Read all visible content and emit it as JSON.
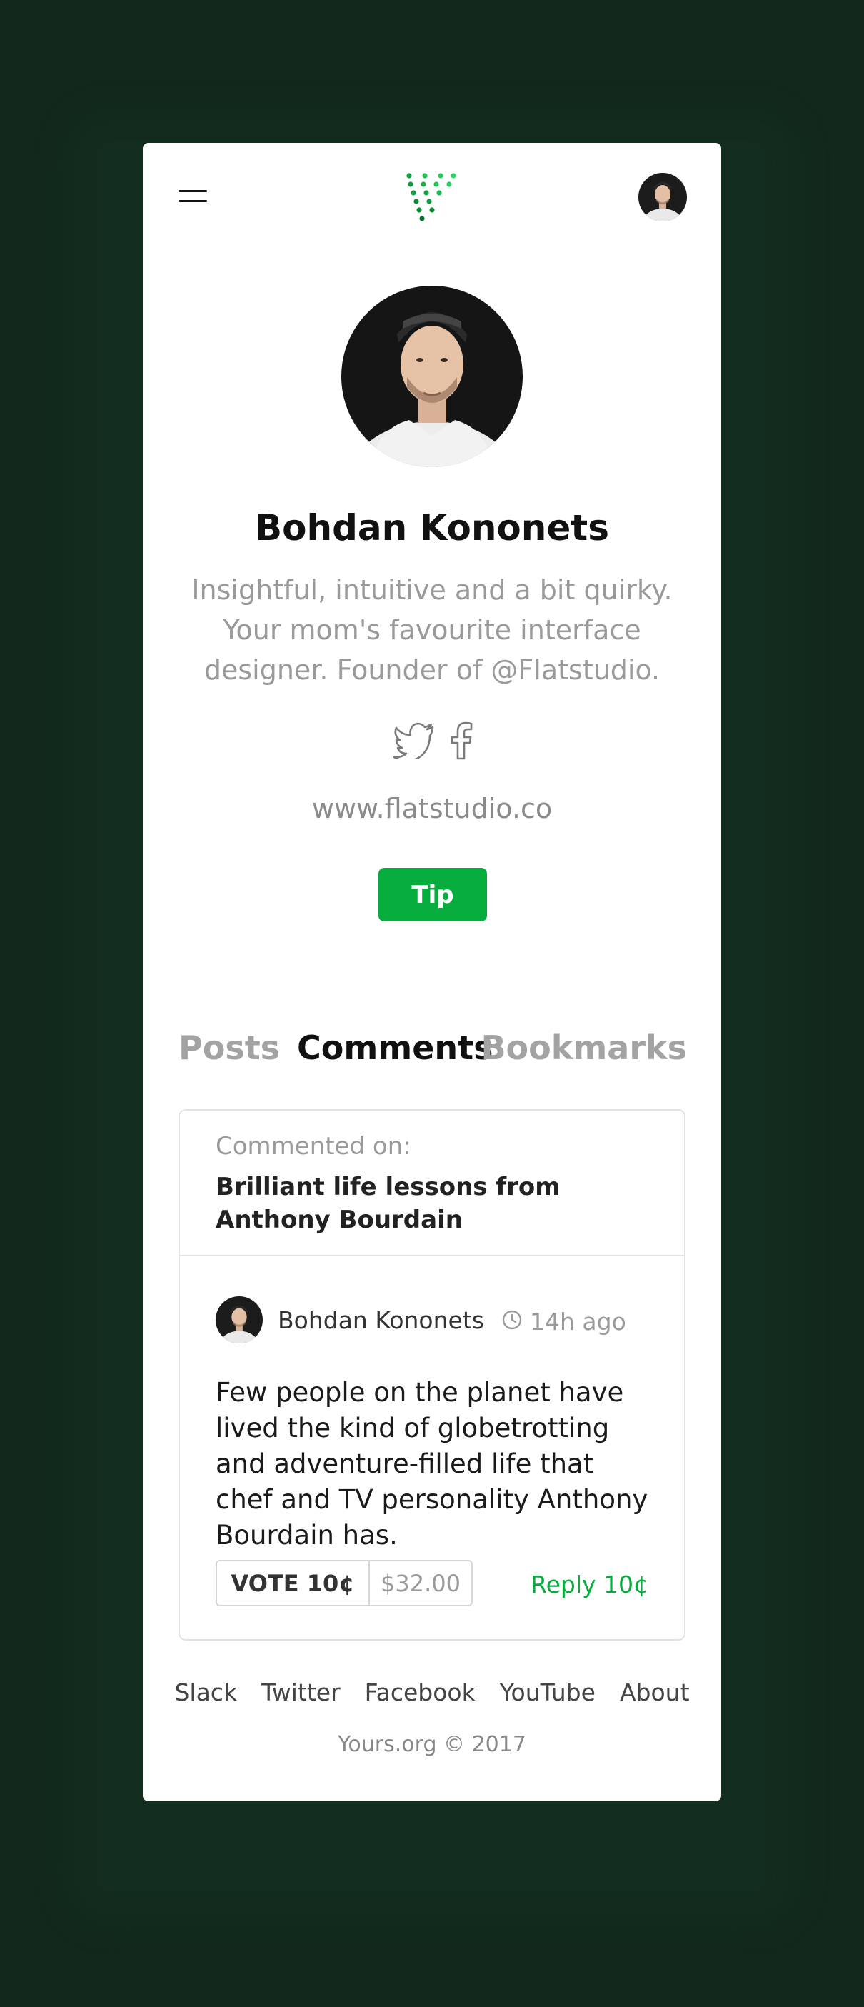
{
  "header": {
    "menu_icon": "hamburger-menu-icon",
    "logo_icon": "green-dots-logo",
    "avatar_icon": "user-avatar"
  },
  "profile": {
    "name": "Bohdan Kononets",
    "bio": "Insightful, intuitive and a bit quirky. Your mom's favourite interface designer. Founder of @Flatstudio.",
    "social_icons": [
      "twitter-icon",
      "facebook-icon"
    ],
    "website": "www.flatstudio.co",
    "tip_label": "Tip"
  },
  "tabs": [
    {
      "label": "Posts",
      "active": false
    },
    {
      "label": "Comments",
      "active": true
    },
    {
      "label": "Bookmarks",
      "active": false
    }
  ],
  "comment": {
    "commented_on_label": "Commented on:",
    "post_title": "Brilliant life lessons from Anthony Bourdain",
    "author": "Bohdan Kononets",
    "time_ago": "14h ago",
    "body": "Few people on the planet have lived the kind of globetrotting and adventure-filled life that chef and TV personality Anthony Bourdain has.",
    "vote_label": "VOTE 10¢",
    "vote_amount": "$32.00",
    "reply_label": "Reply 10¢"
  },
  "footer": {
    "links": [
      "Slack",
      "Twitter",
      "Facebook",
      "YouTube",
      "About"
    ],
    "copyright": "Yours.org © 2017"
  },
  "colors": {
    "background": "#11281b",
    "accent": "#07ad3c",
    "text": "#111111",
    "muted": "#9a9a9a"
  }
}
